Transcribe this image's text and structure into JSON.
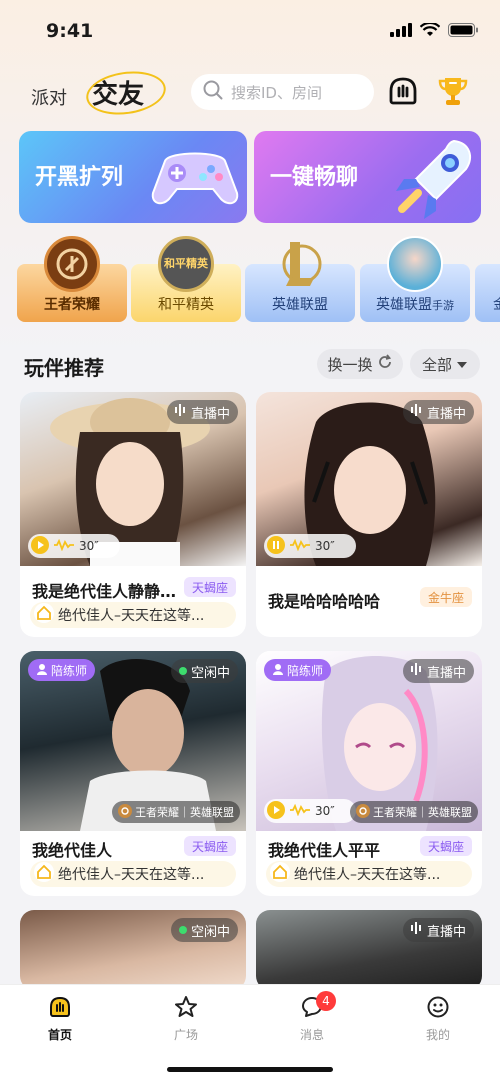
{
  "status_bar": {
    "time": "9:41"
  },
  "header": {
    "tab_party": "派对",
    "tab_friend": "交友",
    "search_placeholder": "搜索ID、房间"
  },
  "banners": [
    {
      "label": "开黑扩列"
    },
    {
      "label": "一键畅聊"
    }
  ],
  "games": [
    {
      "label": "王者荣耀",
      "icon_text": ""
    },
    {
      "label": "和平精英",
      "icon_text": "和平精英"
    },
    {
      "label": "英雄联盟"
    },
    {
      "label": "英雄联盟",
      "suffix": "手游"
    },
    {
      "label": "金"
    }
  ],
  "section": {
    "title": "玩伴推荐",
    "refresh_label": "换一换",
    "filter_label": "全部"
  },
  "cards": [
    {
      "status": "直播中",
      "voice": "30″",
      "name": "我是绝代佳人静静…",
      "zodiac": "天蝎座",
      "desc": "绝代佳人–天天在这等..."
    },
    {
      "status": "直播中",
      "voice": "30″",
      "name": "我是哈哈哈哈哈",
      "zodiac": "金牛座"
    },
    {
      "coach": "陪练师",
      "status": "空闲中",
      "game_tag": "王者荣耀｜英雄联盟",
      "name": "我绝代佳人",
      "zodiac": "天蝎座",
      "desc": "绝代佳人–天天在这等..."
    },
    {
      "coach": "陪练师",
      "status": "直播中",
      "voice": "30″",
      "game_tag": "王者荣耀｜英雄联盟",
      "name": "我绝代佳人平平",
      "zodiac": "天蝎座",
      "desc": "绝代佳人–天天在这等..."
    },
    {
      "status": "空闲中"
    },
    {
      "status": "直播中"
    }
  ],
  "tabbar": {
    "home": "首页",
    "plaza": "广场",
    "messages": "消息",
    "messages_badge": "4",
    "mine": "我的"
  }
}
